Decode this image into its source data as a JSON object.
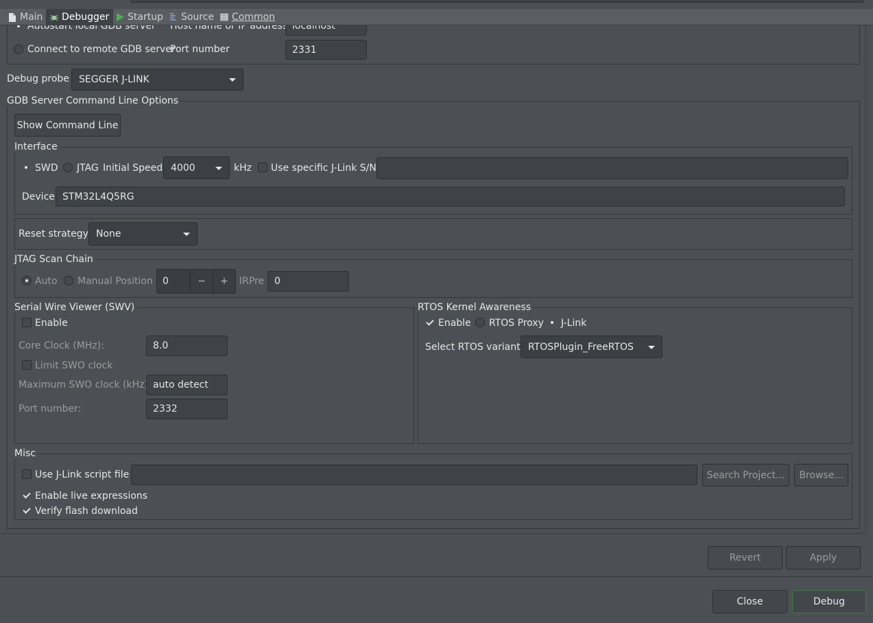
{
  "tabs": [
    {
      "label": "Main",
      "icon": "document-icon"
    },
    {
      "label": "Debugger",
      "icon": "bug-icon"
    },
    {
      "label": "Startup",
      "icon": "play-icon"
    },
    {
      "label": "Source",
      "icon": "source-icon"
    },
    {
      "label": "Common",
      "icon": "common-icon"
    }
  ],
  "active_tab": "Debugger",
  "gdb": {
    "autostart_label": "Autostart local GDB server",
    "host_label": "Host name or IP address",
    "host_value": "localhost",
    "remote_label": "Connect to remote GDB server",
    "port_label": "Port number",
    "port_value": "2331"
  },
  "debug_probe": {
    "label": "Debug probe",
    "value": "SEGGER J-LINK"
  },
  "cmdline": {
    "title": "GDB Server Command Line Options",
    "show_button": "Show Command Line"
  },
  "interface": {
    "title": "Interface",
    "swd": "SWD",
    "jtag": "JTAG",
    "initial_speed_label": "Initial Speed",
    "initial_speed_value": "4000",
    "khz": "kHz",
    "specific_sn_label": "Use specific J-Link S/N",
    "specific_sn_value": "",
    "device_label": "Device",
    "device_value": "STM32L4Q5RG"
  },
  "reset": {
    "label": "Reset strategy",
    "value": "None"
  },
  "jtag_scan": {
    "title": "JTAG Scan Chain",
    "auto": "Auto",
    "manual": "Manual Position",
    "position_value": "0",
    "minus": "−",
    "plus": "+",
    "irpre_label": "IRPre",
    "irpre_value": "0"
  },
  "swv": {
    "title": "Serial Wire Viewer (SWV)",
    "enable": "Enable",
    "core_clock_label": "Core Clock (MHz):",
    "core_clock_value": "8.0",
    "limit_label": "Limit SWO clock",
    "max_clock_label": "Maximum SWO clock (kHz):",
    "max_clock_value": "auto detect",
    "port_label": "Port number:",
    "port_value": "2332"
  },
  "rtos": {
    "title": "RTOS Kernel Awareness",
    "enable": "Enable",
    "proxy": "RTOS Proxy",
    "jlink": "J-Link",
    "variant_label": "Select RTOS variant:",
    "variant_value": "RTOSPlugin_FreeRTOS"
  },
  "misc": {
    "title": "Misc",
    "script_label": "Use J-Link script file",
    "script_value": "",
    "search_button": "Search Project...",
    "browse_button": "Browse...",
    "live_expr": "Enable live expressions",
    "verify_flash": "Verify flash download"
  },
  "footer": {
    "revert": "Revert",
    "apply": "Apply",
    "close": "Close",
    "debug": "Debug"
  }
}
